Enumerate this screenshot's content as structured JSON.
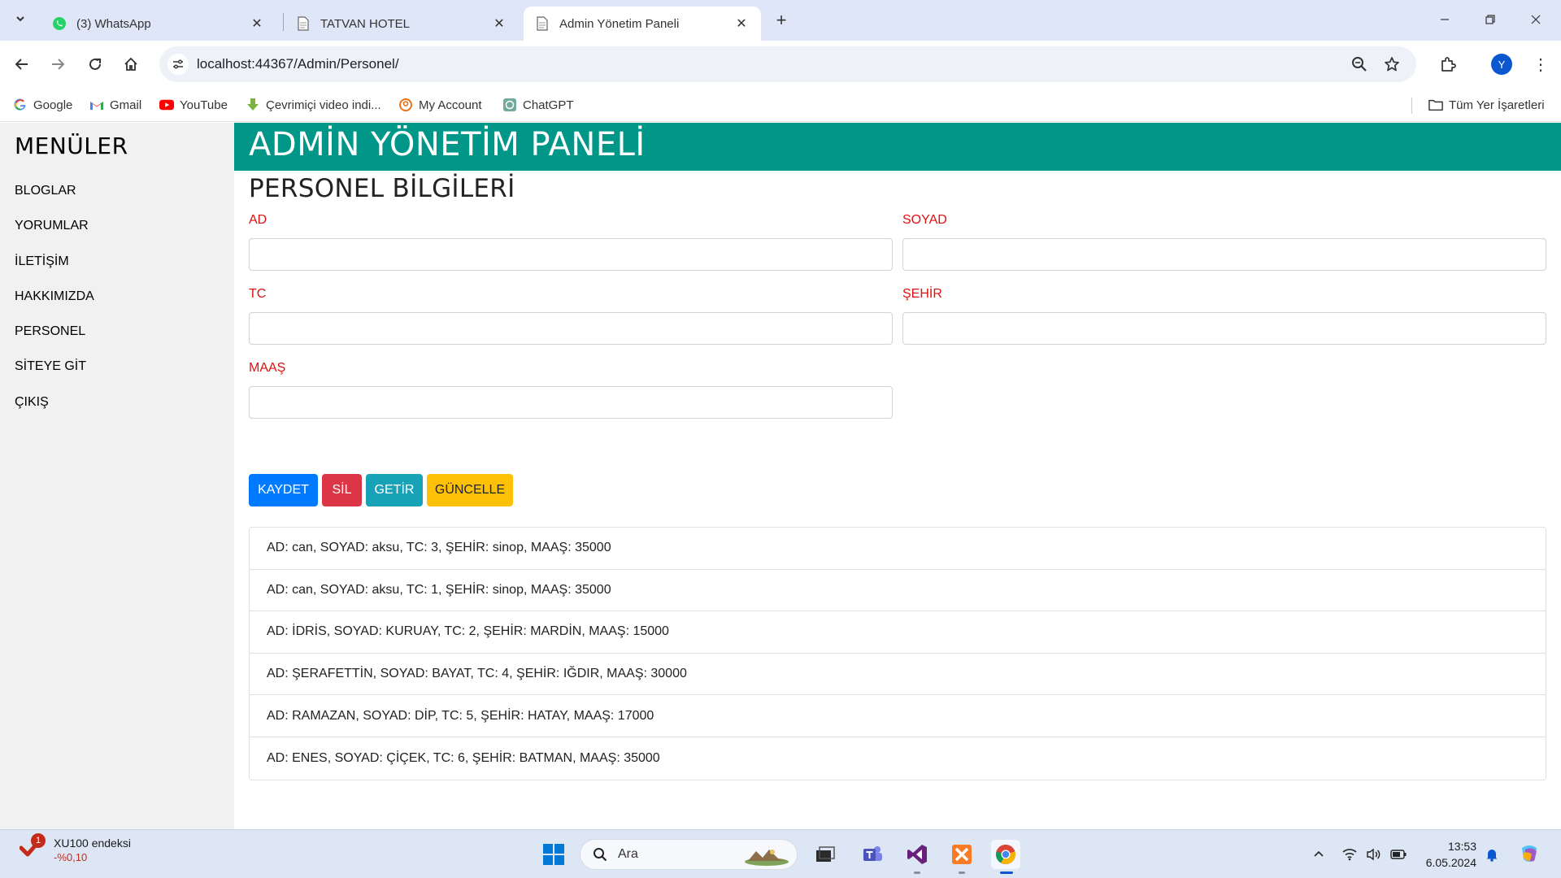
{
  "browser": {
    "tabs": [
      {
        "title": "(3) WhatsApp",
        "icon": "whatsapp-icon"
      },
      {
        "title": "TATVAN HOTEL",
        "icon": "page-icon"
      },
      {
        "title": "Admin Yönetim Paneli",
        "icon": "page-icon",
        "active": true
      }
    ],
    "url": "localhost:44367/Admin/Personel/",
    "profile_initial": "Y",
    "bookmarks": [
      {
        "label": "Google",
        "icon": "google-icon"
      },
      {
        "label": "Gmail",
        "icon": "gmail-icon"
      },
      {
        "label": "YouTube",
        "icon": "youtube-icon"
      },
      {
        "label": "Çevrimiçi video indi...",
        "icon": "download-icon"
      },
      {
        "label": "My Account",
        "icon": "account-icon"
      },
      {
        "label": "ChatGPT",
        "icon": "chatgpt-icon"
      }
    ],
    "all_bookmarks": "Tüm Yer İşaretleri"
  },
  "sidebar": {
    "title": "MENÜLER",
    "items": [
      "BLOGLAR",
      "YORUMLAR",
      "İLETİŞİM",
      "HAKKIMIZDA",
      "PERSONEL",
      "SİTEYE GİT",
      "ÇIKIŞ"
    ]
  },
  "header": {
    "title": "ADMİN YÖNETİM PANELİ",
    "color": "#009688"
  },
  "form": {
    "title": "PERSONEL BİLGİLERİ",
    "fields": {
      "ad": {
        "label": "AD",
        "value": ""
      },
      "soyad": {
        "label": "SOYAD",
        "value": ""
      },
      "tc": {
        "label": "TC",
        "value": ""
      },
      "sehir": {
        "label": "ŞEHİR",
        "value": ""
      },
      "maas": {
        "label": "MAAŞ",
        "value": ""
      }
    },
    "buttons": {
      "kaydet": "KAYDET",
      "sil": "SİL",
      "getir": "GETİR",
      "guncelle": "GÜNCELLE"
    }
  },
  "personel_list": [
    "AD: can, SOYAD: aksu, TC: 3, ŞEHİR: sinop, MAAŞ: 35000",
    "AD: can, SOYAD: aksu, TC: 1, ŞEHİR: sinop, MAAŞ: 35000",
    "AD: İDRİS, SOYAD: KURUAY, TC: 2, ŞEHİR: MARDİN, MAAŞ: 15000",
    "AD: ŞERAFETTİN, SOYAD: BAYAT, TC: 4, ŞEHİR: IĞDIR, MAAŞ: 30000",
    "AD: RAMAZAN, SOYAD: DİP, TC: 5, ŞEHİR: HATAY, MAAŞ: 17000",
    "AD: ENES, SOYAD: ÇİÇEK, TC: 6, ŞEHİR: BATMAN, MAAŞ: 35000"
  ],
  "taskbar": {
    "widget_title": "XU100 endeksi",
    "widget_value": "-%0,10",
    "widget_badge": "1",
    "search_placeholder": "Ara",
    "time": "13:53",
    "date": "6.05.2024"
  }
}
